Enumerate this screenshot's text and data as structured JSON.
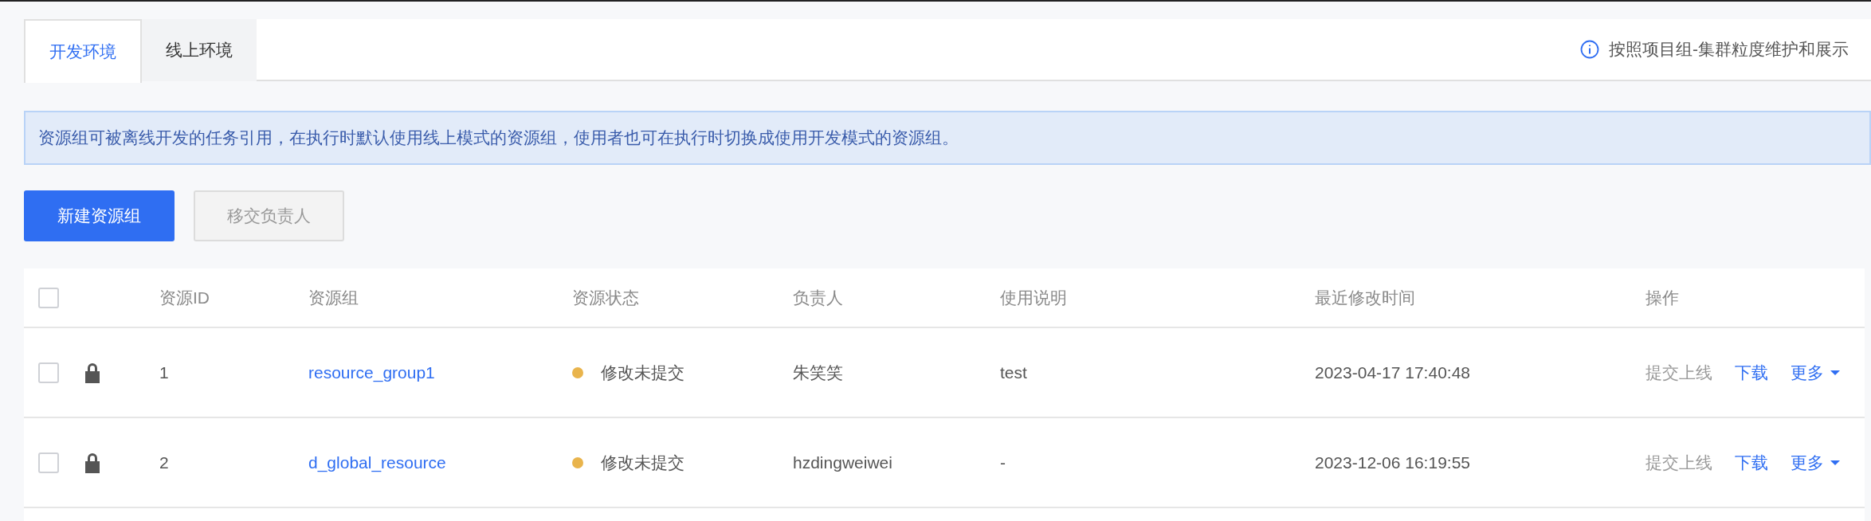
{
  "tabs": [
    {
      "label": "开发环境",
      "selected": true
    },
    {
      "label": "线上环境",
      "selected": false
    }
  ],
  "info_note": "按照项目组-集群粒度维护和展示",
  "alert": "资源组可被离线开发的任务引用，在执行时默认使用线上模式的资源组，使用者也可在执行时切换成使用开发模式的资源组。",
  "buttons": [
    {
      "label": "新建资源组",
      "kind": "primary",
      "disabled": false
    },
    {
      "label": "移交负责人",
      "kind": "default",
      "disabled": true
    }
  ],
  "table": {
    "select_all": {
      "checked": false
    },
    "columns": [
      "资源ID",
      "资源组",
      "资源状态",
      "负责人",
      "使用说明",
      "最近修改时间",
      "操作"
    ],
    "rows": [
      {
        "checked": false,
        "locked": true,
        "id": "1",
        "group": "resource_group1",
        "status": "修改未提交",
        "color": "#e9b44c",
        "owner": "朱笑笑",
        "description": "test",
        "modified": "2023-04-17 17:40:48",
        "actions": [
          {
            "label": "提交上线",
            "disabled": true
          },
          {
            "label": "下载",
            "disabled": false
          },
          {
            "label": "更多",
            "disabled": false,
            "dropdown": true
          }
        ]
      },
      {
        "checked": false,
        "locked": true,
        "id": "2",
        "group": "d_global_resource",
        "status": "修改未提交",
        "color": "#e9b44c",
        "owner": "hzdingweiwei",
        "description": "-",
        "modified": "2023-12-06 16:19:55",
        "actions": [
          {
            "label": "提交上线",
            "disabled": true
          },
          {
            "label": "下载",
            "disabled": false
          },
          {
            "label": "更多",
            "disabled": false,
            "dropdown": true
          }
        ]
      }
    ]
  }
}
